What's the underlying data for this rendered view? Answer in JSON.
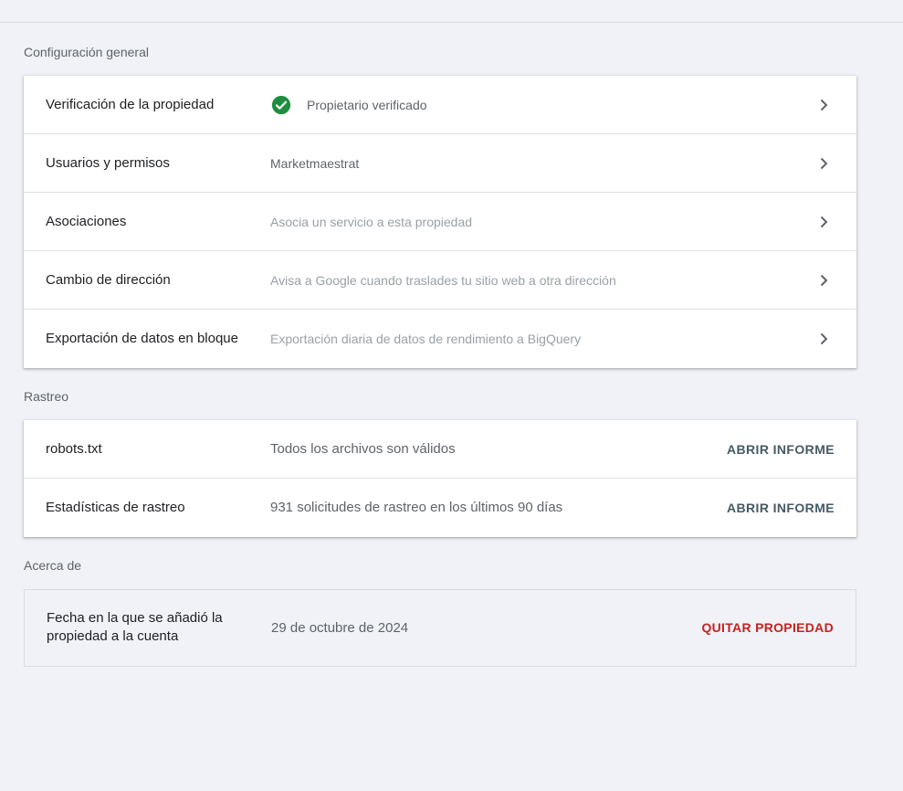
{
  "sections": {
    "general": {
      "title": "Configuración general",
      "rows": [
        {
          "label": "Verificación de la propiedad",
          "value": "Propietario verificado",
          "icon": "check-circle-icon",
          "icon_color": "#1e8e3e"
        },
        {
          "label": "Usuarios y permisos",
          "value": "Marketmaestrat"
        },
        {
          "label": "Asociaciones",
          "value": "Asocia un servicio a esta propiedad"
        },
        {
          "label": "Cambio de dirección",
          "value": "Avisa a Google cuando traslades tu sitio web a otra dirección"
        },
        {
          "label": "Exportación de datos en bloque",
          "value": "Exportación diaria de datos de rendimiento a BigQuery"
        }
      ]
    },
    "crawl": {
      "title": "Rastreo",
      "rows": [
        {
          "label": "robots.txt",
          "value": "Todos los archivos son válidos",
          "action": "ABRIR INFORME"
        },
        {
          "label": "Estadísticas de rastreo",
          "value": "931 solicitudes de rastreo en los últimos 90 días",
          "action": "ABRIR INFORME"
        }
      ]
    },
    "about": {
      "title": "Acerca de",
      "label": "Fecha en la que se añadió la propiedad a la cuenta",
      "value": "29 de octubre de 2024",
      "action": "QUITAR PROPIEDAD",
      "action_color": "#c5221f"
    }
  }
}
